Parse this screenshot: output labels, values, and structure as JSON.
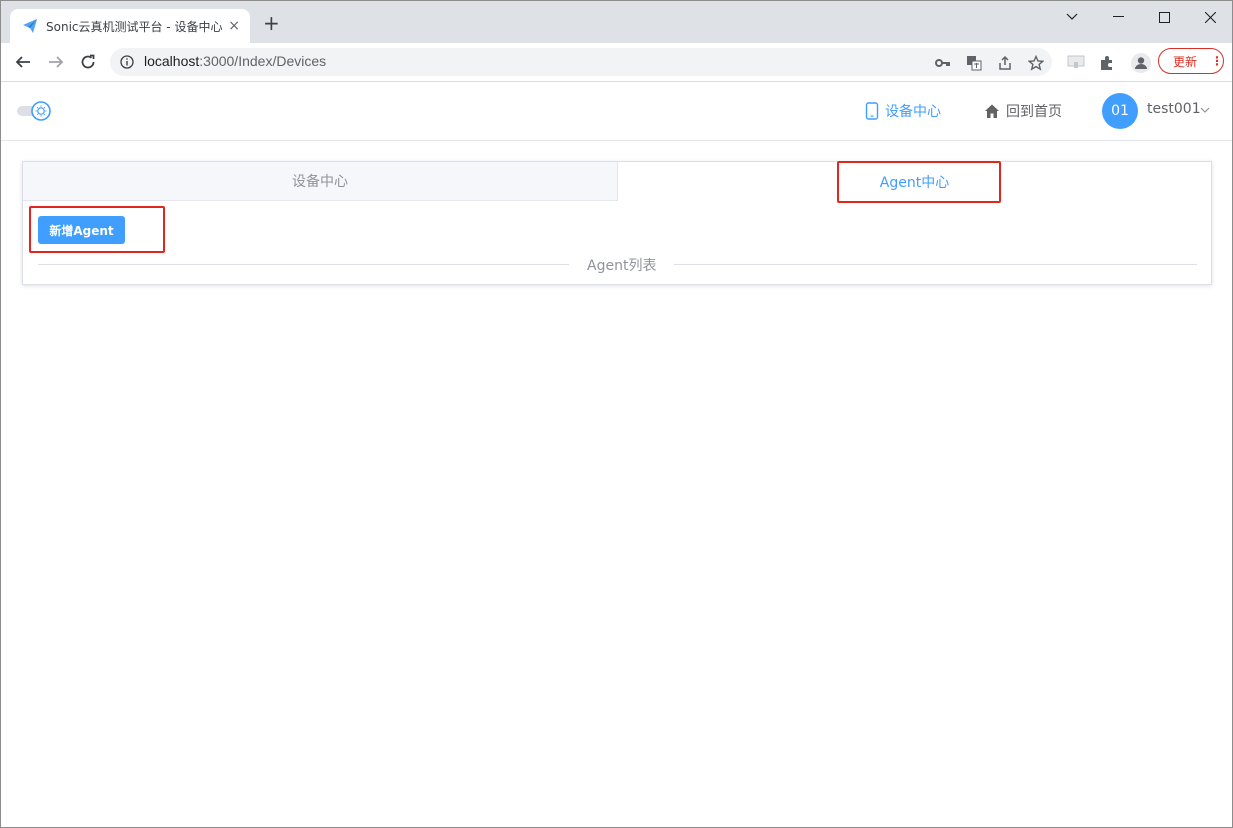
{
  "browser": {
    "tab_title": "Sonic云真机测试平台 - 设备中心",
    "tab_close": "×",
    "new_tab": "+",
    "url_host": "localhost",
    "url_path": ":3000/Index/Devices",
    "update_label": "更新",
    "update_menu": "⋮"
  },
  "header": {
    "nav_device_center": "设备中心",
    "nav_home": "回到首页",
    "avatar_text": "01",
    "username": "test001"
  },
  "tabs": [
    {
      "label": "设备中心",
      "active": false
    },
    {
      "label": "Agent中心",
      "active": true
    }
  ],
  "content": {
    "add_agent_label": "新增Agent",
    "agent_list_title": "Agent列表"
  },
  "colors": {
    "primary": "#409eff",
    "annotation": "#e3261d",
    "update": "#d93025"
  }
}
